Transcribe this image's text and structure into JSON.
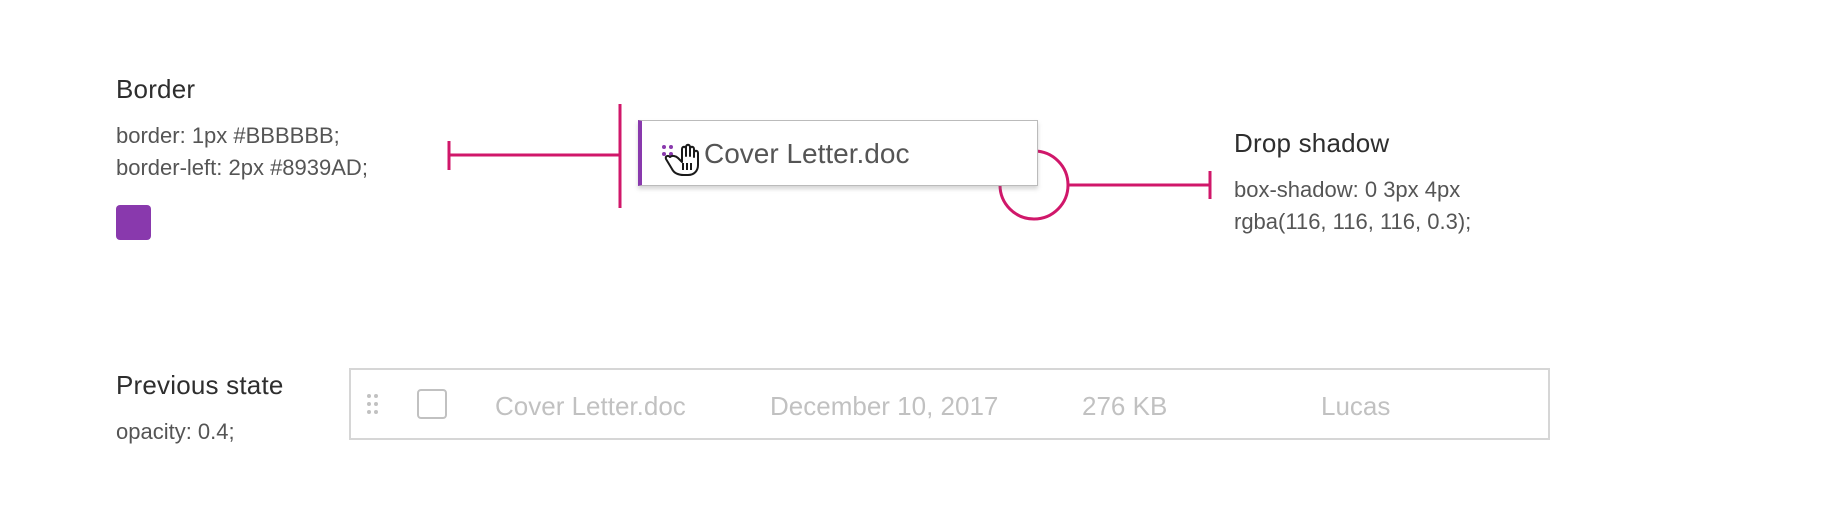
{
  "border_section": {
    "heading": "Border",
    "spec_line_1": "border: 1px #BBBBBB;",
    "spec_line_2": "border-left: 2px #8939AD;",
    "swatch_color": "#8939AD"
  },
  "drop_shadow_section": {
    "heading": "Drop shadow",
    "spec_line_1": "box-shadow: 0 3px 4px",
    "spec_line_2": "rgba(116, 116, 116, 0.3);"
  },
  "dragged_item": {
    "file_name": "Cover Letter.doc",
    "grip_icon": "drag-handle-icon",
    "cursor_icon": "grab-hand-icon",
    "accent_color": "#8939AD"
  },
  "previous_state_section": {
    "heading": "Previous state",
    "spec": "opacity: 0.4;",
    "row": {
      "file_name": "Cover Letter.doc",
      "date": "December 10, 2017",
      "size": "276 KB",
      "owner": "Lucas"
    }
  },
  "colors": {
    "annotation": "#D0176A",
    "border": "#BBBBBB",
    "accent": "#8939AD"
  }
}
